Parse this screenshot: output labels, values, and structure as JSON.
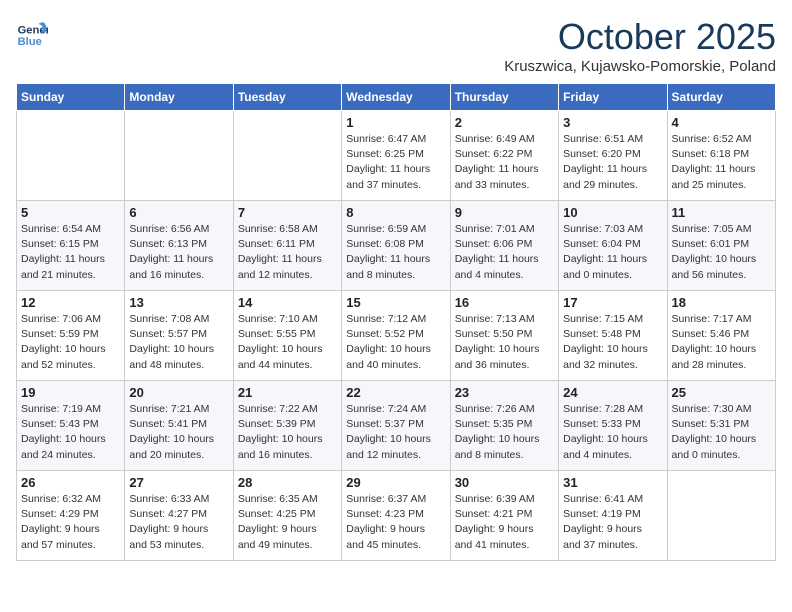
{
  "logo": {
    "line1": "General",
    "line2": "Blue"
  },
  "title": "October 2025",
  "subtitle": "Kruszwica, Kujawsko-Pomorskie, Poland",
  "weekdays": [
    "Sunday",
    "Monday",
    "Tuesday",
    "Wednesday",
    "Thursday",
    "Friday",
    "Saturday"
  ],
  "weeks": [
    [
      {
        "num": "",
        "info": ""
      },
      {
        "num": "",
        "info": ""
      },
      {
        "num": "",
        "info": ""
      },
      {
        "num": "1",
        "info": "Sunrise: 6:47 AM\nSunset: 6:25 PM\nDaylight: 11 hours\nand 37 minutes."
      },
      {
        "num": "2",
        "info": "Sunrise: 6:49 AM\nSunset: 6:22 PM\nDaylight: 11 hours\nand 33 minutes."
      },
      {
        "num": "3",
        "info": "Sunrise: 6:51 AM\nSunset: 6:20 PM\nDaylight: 11 hours\nand 29 minutes."
      },
      {
        "num": "4",
        "info": "Sunrise: 6:52 AM\nSunset: 6:18 PM\nDaylight: 11 hours\nand 25 minutes."
      }
    ],
    [
      {
        "num": "5",
        "info": "Sunrise: 6:54 AM\nSunset: 6:15 PM\nDaylight: 11 hours\nand 21 minutes."
      },
      {
        "num": "6",
        "info": "Sunrise: 6:56 AM\nSunset: 6:13 PM\nDaylight: 11 hours\nand 16 minutes."
      },
      {
        "num": "7",
        "info": "Sunrise: 6:58 AM\nSunset: 6:11 PM\nDaylight: 11 hours\nand 12 minutes."
      },
      {
        "num": "8",
        "info": "Sunrise: 6:59 AM\nSunset: 6:08 PM\nDaylight: 11 hours\nand 8 minutes."
      },
      {
        "num": "9",
        "info": "Sunrise: 7:01 AM\nSunset: 6:06 PM\nDaylight: 11 hours\nand 4 minutes."
      },
      {
        "num": "10",
        "info": "Sunrise: 7:03 AM\nSunset: 6:04 PM\nDaylight: 11 hours\nand 0 minutes."
      },
      {
        "num": "11",
        "info": "Sunrise: 7:05 AM\nSunset: 6:01 PM\nDaylight: 10 hours\nand 56 minutes."
      }
    ],
    [
      {
        "num": "12",
        "info": "Sunrise: 7:06 AM\nSunset: 5:59 PM\nDaylight: 10 hours\nand 52 minutes."
      },
      {
        "num": "13",
        "info": "Sunrise: 7:08 AM\nSunset: 5:57 PM\nDaylight: 10 hours\nand 48 minutes."
      },
      {
        "num": "14",
        "info": "Sunrise: 7:10 AM\nSunset: 5:55 PM\nDaylight: 10 hours\nand 44 minutes."
      },
      {
        "num": "15",
        "info": "Sunrise: 7:12 AM\nSunset: 5:52 PM\nDaylight: 10 hours\nand 40 minutes."
      },
      {
        "num": "16",
        "info": "Sunrise: 7:13 AM\nSunset: 5:50 PM\nDaylight: 10 hours\nand 36 minutes."
      },
      {
        "num": "17",
        "info": "Sunrise: 7:15 AM\nSunset: 5:48 PM\nDaylight: 10 hours\nand 32 minutes."
      },
      {
        "num": "18",
        "info": "Sunrise: 7:17 AM\nSunset: 5:46 PM\nDaylight: 10 hours\nand 28 minutes."
      }
    ],
    [
      {
        "num": "19",
        "info": "Sunrise: 7:19 AM\nSunset: 5:43 PM\nDaylight: 10 hours\nand 24 minutes."
      },
      {
        "num": "20",
        "info": "Sunrise: 7:21 AM\nSunset: 5:41 PM\nDaylight: 10 hours\nand 20 minutes."
      },
      {
        "num": "21",
        "info": "Sunrise: 7:22 AM\nSunset: 5:39 PM\nDaylight: 10 hours\nand 16 minutes."
      },
      {
        "num": "22",
        "info": "Sunrise: 7:24 AM\nSunset: 5:37 PM\nDaylight: 10 hours\nand 12 minutes."
      },
      {
        "num": "23",
        "info": "Sunrise: 7:26 AM\nSunset: 5:35 PM\nDaylight: 10 hours\nand 8 minutes."
      },
      {
        "num": "24",
        "info": "Sunrise: 7:28 AM\nSunset: 5:33 PM\nDaylight: 10 hours\nand 4 minutes."
      },
      {
        "num": "25",
        "info": "Sunrise: 7:30 AM\nSunset: 5:31 PM\nDaylight: 10 hours\nand 0 minutes."
      }
    ],
    [
      {
        "num": "26",
        "info": "Sunrise: 6:32 AM\nSunset: 4:29 PM\nDaylight: 9 hours\nand 57 minutes."
      },
      {
        "num": "27",
        "info": "Sunrise: 6:33 AM\nSunset: 4:27 PM\nDaylight: 9 hours\nand 53 minutes."
      },
      {
        "num": "28",
        "info": "Sunrise: 6:35 AM\nSunset: 4:25 PM\nDaylight: 9 hours\nand 49 minutes."
      },
      {
        "num": "29",
        "info": "Sunrise: 6:37 AM\nSunset: 4:23 PM\nDaylight: 9 hours\nand 45 minutes."
      },
      {
        "num": "30",
        "info": "Sunrise: 6:39 AM\nSunset: 4:21 PM\nDaylight: 9 hours\nand 41 minutes."
      },
      {
        "num": "31",
        "info": "Sunrise: 6:41 AM\nSunset: 4:19 PM\nDaylight: 9 hours\nand 37 minutes."
      },
      {
        "num": "",
        "info": ""
      }
    ]
  ]
}
